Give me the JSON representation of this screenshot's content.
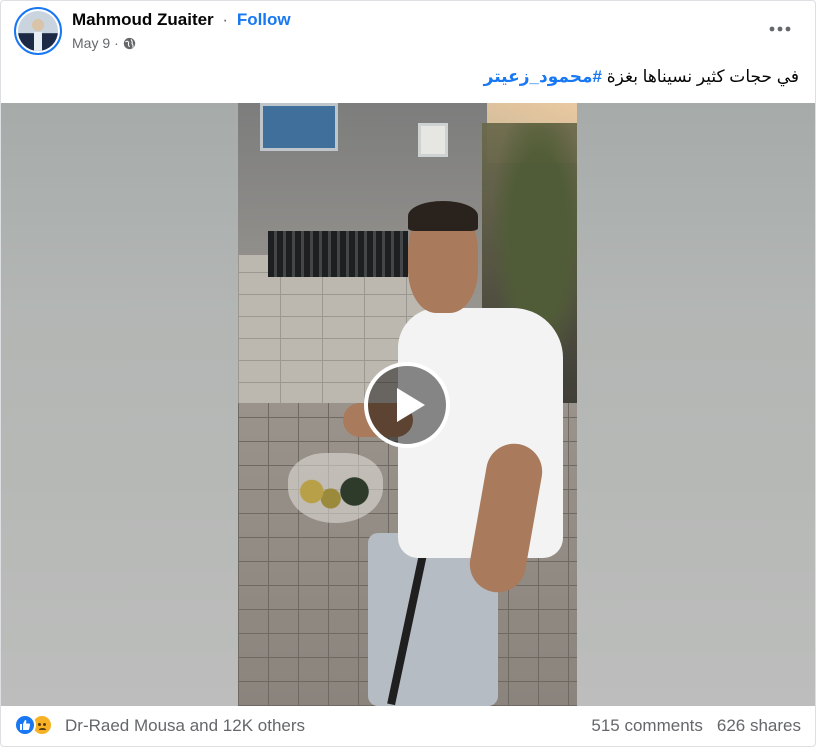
{
  "author": {
    "name": "Mahmoud Zuaiter",
    "separator": "·",
    "follow_label": "Follow",
    "date": "May 9",
    "separator2": "·"
  },
  "caption": {
    "text": "في حجات كثير نسيناها بغزة ",
    "hashtag": "#محمود_زعيتر"
  },
  "icons": {
    "more": "more-horizontal-icon",
    "privacy": "globe-icon",
    "play": "play-icon",
    "like": "like-icon",
    "sad": "sad-icon"
  },
  "video": {
    "state": "paused"
  },
  "footer": {
    "reactors": "Dr-Raed Mousa and 12K others",
    "comments": "515 comments",
    "shares": "626 shares"
  },
  "colors": {
    "accent": "#1877f2",
    "muted": "#65676b",
    "sad": "#f7b125"
  }
}
